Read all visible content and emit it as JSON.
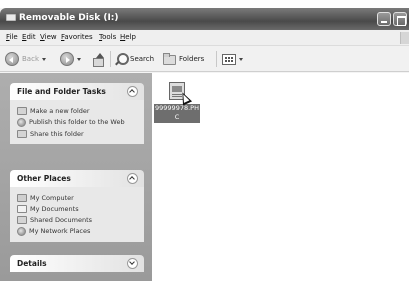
{
  "window": {
    "title": "Removable Disk (I:)"
  },
  "menu": {
    "items": [
      "File",
      "Edit",
      "View",
      "Favorites",
      "Tools",
      "Help"
    ]
  },
  "toolbar": {
    "back_label": "Back",
    "search_label": "Search",
    "folders_label": "Folders"
  },
  "taskpane": {
    "file_folder_tasks": {
      "title": "File and Folder Tasks",
      "items": [
        "Make a new folder",
        "Publish this folder to the Web",
        "Share this folder"
      ]
    },
    "other_places": {
      "title": "Other Places",
      "items": [
        "My Computer",
        "My Documents",
        "Shared Documents",
        "My Network Places"
      ]
    },
    "details": {
      "title": "Details"
    }
  },
  "content": {
    "files": [
      {
        "name": "99999978.PHC",
        "icon": "file-icon",
        "selected": true
      }
    ]
  },
  "colors": {
    "titlebar": "#5a5a5a",
    "taskpane_bg": "#a6a6a6",
    "selection": "#6e6e6e"
  }
}
